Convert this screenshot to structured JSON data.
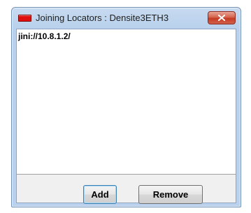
{
  "window": {
    "title": "Joining Locators : Densite3ETH3",
    "icon": "app-icon",
    "close_icon": "close-icon"
  },
  "locators": {
    "items": [
      "jini://10.8.1.2/"
    ]
  },
  "buttons": {
    "add_label": "Add",
    "remove_label": "Remove"
  },
  "colors": {
    "app_icon": "#e01010",
    "close_button": "#c43b22",
    "frame": "#b9d1ec"
  }
}
